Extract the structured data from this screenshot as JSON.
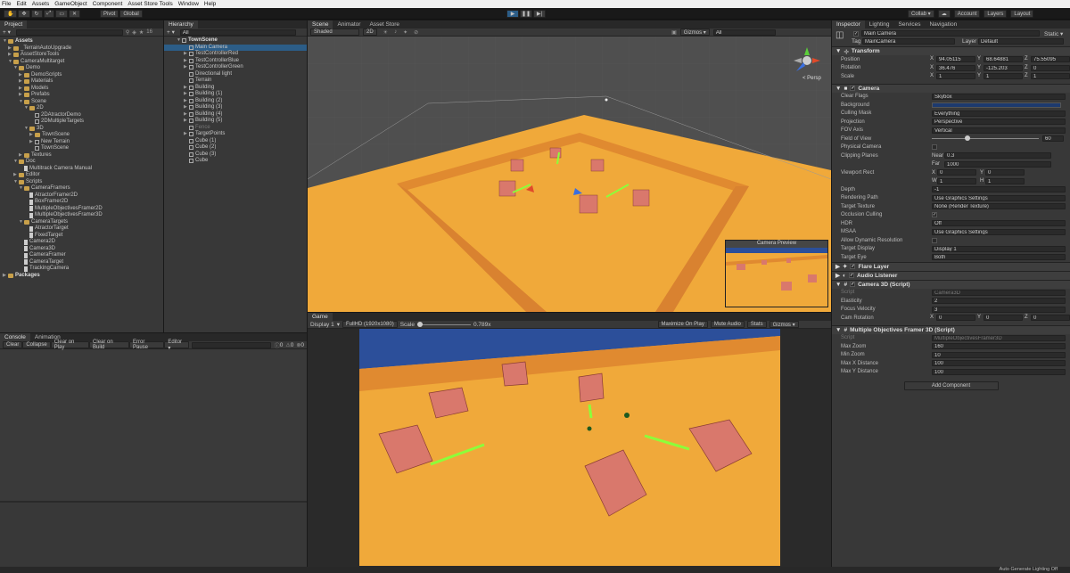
{
  "menu": [
    "File",
    "Edit",
    "Assets",
    "GameObject",
    "Component",
    "Asset Store Tools",
    "Window",
    "Help"
  ],
  "toolbar": {
    "pivot": "Pivot",
    "global": "Global",
    "collab": "Collab ▾",
    "account": "Account",
    "layers": "Layers",
    "layout": "Layout"
  },
  "project": {
    "tab": "Project",
    "count": "16",
    "items": [
      {
        "label": "Assets",
        "depth": 0,
        "bold": true,
        "arrow": "▼",
        "icon": "folder"
      },
      {
        "label": "_TerrainAutoUpgrade",
        "depth": 1,
        "arrow": "▶",
        "icon": "folder"
      },
      {
        "label": "AssetStoreTools",
        "depth": 1,
        "arrow": "▶",
        "icon": "folder"
      },
      {
        "label": "CameraMultitarget",
        "depth": 1,
        "arrow": "▼",
        "icon": "folder"
      },
      {
        "label": "Demo",
        "depth": 2,
        "arrow": "▼",
        "icon": "folder"
      },
      {
        "label": "DemoScripts",
        "depth": 3,
        "arrow": "▶",
        "icon": "folder"
      },
      {
        "label": "Materials",
        "depth": 3,
        "arrow": "▶",
        "icon": "folder"
      },
      {
        "label": "Models",
        "depth": 3,
        "arrow": "▶",
        "icon": "folder"
      },
      {
        "label": "Prefabs",
        "depth": 3,
        "arrow": "▶",
        "icon": "folder"
      },
      {
        "label": "Scene",
        "depth": 3,
        "arrow": "▼",
        "icon": "folder"
      },
      {
        "label": "2D",
        "depth": 4,
        "arrow": "▼",
        "icon": "folder"
      },
      {
        "label": "2DAtractorDemo",
        "depth": 5,
        "arrow": "",
        "icon": "cube"
      },
      {
        "label": "2DMultipleTargets",
        "depth": 5,
        "arrow": "",
        "icon": "cube"
      },
      {
        "label": "3D",
        "depth": 4,
        "arrow": "▼",
        "icon": "folder"
      },
      {
        "label": "TownScene",
        "depth": 5,
        "arrow": "▶",
        "icon": "folder"
      },
      {
        "label": "New Terrain",
        "depth": 5,
        "arrow": "▶",
        "icon": "cube"
      },
      {
        "label": "TownScene",
        "depth": 5,
        "arrow": "",
        "icon": "cube"
      },
      {
        "label": "Textures",
        "depth": 3,
        "arrow": "▶",
        "icon": "folder"
      },
      {
        "label": "Doc",
        "depth": 2,
        "arrow": "▼",
        "icon": "folder"
      },
      {
        "label": "Multitrack Camera Manual",
        "depth": 3,
        "arrow": "",
        "icon": "script"
      },
      {
        "label": "Editor",
        "depth": 2,
        "arrow": "▶",
        "icon": "folder"
      },
      {
        "label": "Scripts",
        "depth": 2,
        "arrow": "▼",
        "icon": "folder"
      },
      {
        "label": "CameraFramers",
        "depth": 3,
        "arrow": "▼",
        "icon": "folder"
      },
      {
        "label": "AtractorFramer2D",
        "depth": 4,
        "arrow": "",
        "icon": "script"
      },
      {
        "label": "BoxFramer2D",
        "depth": 4,
        "arrow": "",
        "icon": "script"
      },
      {
        "label": "MultipleObjectivesFramer2D",
        "depth": 4,
        "arrow": "",
        "icon": "script"
      },
      {
        "label": "MultipleObjectivesFramer3D",
        "depth": 4,
        "arrow": "",
        "icon": "script"
      },
      {
        "label": "CameraTargets",
        "depth": 3,
        "arrow": "▼",
        "icon": "folder"
      },
      {
        "label": "AtractorTarget",
        "depth": 4,
        "arrow": "",
        "icon": "script"
      },
      {
        "label": "FixedTarget",
        "depth": 4,
        "arrow": "",
        "icon": "script"
      },
      {
        "label": "Camera2D",
        "depth": 3,
        "arrow": "",
        "icon": "script"
      },
      {
        "label": "Camera3D",
        "depth": 3,
        "arrow": "",
        "icon": "script"
      },
      {
        "label": "CameraFramer",
        "depth": 3,
        "arrow": "",
        "icon": "script"
      },
      {
        "label": "CameraTarget",
        "depth": 3,
        "arrow": "",
        "icon": "script"
      },
      {
        "label": "TrackingCamera",
        "depth": 3,
        "arrow": "",
        "icon": "script"
      },
      {
        "label": "Packages",
        "depth": 0,
        "bold": true,
        "arrow": "▶",
        "icon": "folder"
      }
    ]
  },
  "hierarchy": {
    "tab": "Hierarchy",
    "items": [
      {
        "label": "TownScene",
        "depth": 0,
        "arrow": "▼",
        "bold": true
      },
      {
        "label": "Main Camera",
        "depth": 1,
        "arrow": "",
        "selected": true
      },
      {
        "label": "TestControllerRed",
        "depth": 1,
        "arrow": "▶"
      },
      {
        "label": "TestControllerBlue",
        "depth": 1,
        "arrow": "▶"
      },
      {
        "label": "TestControllerGreen",
        "depth": 1,
        "arrow": "▶"
      },
      {
        "label": "Directional light",
        "depth": 1,
        "arrow": ""
      },
      {
        "label": "Terrain",
        "depth": 1,
        "arrow": ""
      },
      {
        "label": "Building",
        "depth": 1,
        "arrow": "▶"
      },
      {
        "label": "Building (1)",
        "depth": 1,
        "arrow": "▶"
      },
      {
        "label": "Building (2)",
        "depth": 1,
        "arrow": "▶"
      },
      {
        "label": "Building (3)",
        "depth": 1,
        "arrow": "▶"
      },
      {
        "label": "Building (4)",
        "depth": 1,
        "arrow": "▶"
      },
      {
        "label": "Building (5)",
        "depth": 1,
        "arrow": "▶"
      },
      {
        "label": "Fence",
        "depth": 1,
        "arrow": "",
        "dim": true
      },
      {
        "label": "TargetPoints",
        "depth": 1,
        "arrow": "▶"
      },
      {
        "label": "Cube (1)",
        "depth": 1,
        "arrow": ""
      },
      {
        "label": "Cube (2)",
        "depth": 1,
        "arrow": ""
      },
      {
        "label": "Cube (3)",
        "depth": 1,
        "arrow": ""
      },
      {
        "label": "Cube",
        "depth": 1,
        "arrow": ""
      }
    ]
  },
  "console": {
    "tabs": [
      "Console",
      "Animation"
    ],
    "buttons": [
      "Clear",
      "Collapse",
      "Clear on Play",
      "Clear on Build",
      "Error Pause",
      "Editor ▾"
    ],
    "counts": [
      "0",
      "0",
      "0"
    ]
  },
  "scene": {
    "tabs": [
      "Scene",
      "Animator",
      "Asset Store"
    ],
    "shading": "Shaded",
    "mode2d": "2D",
    "gizmos": "Gizmos ▾",
    "search": "All",
    "persp": "< Persp",
    "preview_title": "Camera Preview"
  },
  "game": {
    "tab": "Game",
    "display": "Display 1",
    "resolution": "FullHD (1920x1080)",
    "scale_label": "Scale",
    "scale_value": "0.789x",
    "maximize": "Maximize On Play",
    "mute": "Mute Audio",
    "stats": "Stats",
    "gizmos": "Gizmos ▾"
  },
  "inspector": {
    "tabs": [
      "Inspector",
      "Lighting",
      "Services",
      "Navigation"
    ],
    "object_name": "Main Camera",
    "static": "Static ▾",
    "tag_label": "Tag",
    "tag": "MainCamera",
    "layer_label": "Layer",
    "layer": "Default",
    "transform": {
      "title": "Transform",
      "position": [
        "94.05115",
        "68.64881",
        "75.55095"
      ],
      "rotation": [
        "36.476",
        "-125.203",
        "0"
      ],
      "scale": [
        "1",
        "1",
        "1"
      ],
      "labels": [
        "Position",
        "Rotation",
        "Scale"
      ]
    },
    "camera": {
      "title": "Camera",
      "fields": [
        [
          "Clear Flags",
          "Skybox"
        ],
        [
          "Background",
          ""
        ],
        [
          "Culling Mask",
          "Everything"
        ],
        [
          "Projection",
          "Perspective"
        ],
        [
          "FOV Axis",
          "Vertical"
        ],
        [
          "Field of View",
          "60"
        ],
        [
          "Physical Camera",
          ""
        ],
        [
          "Clipping Planes",
          ""
        ],
        [
          "",
          ""
        ],
        [
          "Viewport Rect",
          ""
        ],
        [
          "",
          ""
        ],
        [
          "Depth",
          "-1"
        ],
        [
          "Rendering Path",
          "Use Graphics Settings"
        ],
        [
          "Target Texture",
          "None (Render Texture)"
        ],
        [
          "Occlusion Culling",
          ""
        ],
        [
          "HDR",
          "Off"
        ],
        [
          "MSAA",
          "Use Graphics Settings"
        ],
        [
          "Allow Dynamic Resolution",
          ""
        ],
        [
          "Target Display",
          "Display 1"
        ],
        [
          "Target Eye",
          "Both"
        ]
      ],
      "near": "0.3",
      "far": "1000",
      "vx": "0",
      "vy": "0",
      "vw": "1",
      "vh": "1"
    },
    "flare": "Flare Layer",
    "audio": "Audio Listener",
    "camera3d": {
      "title": "Camera 3D (Script)",
      "script": "Camera3D",
      "fields": [
        [
          "Script",
          "Camera3D"
        ],
        [
          "Elasticity",
          "2"
        ],
        [
          "Focus Velocity",
          "3"
        ],
        [
          "Cam Rotation",
          ""
        ]
      ],
      "rot": [
        "0",
        "0",
        "0"
      ]
    },
    "framer": {
      "title": "Multiple Objectives Framer 3D (Script)",
      "fields": [
        [
          "Script",
          "MultipleObjectivesFramer3D"
        ],
        [
          "Max Zoom",
          "160"
        ],
        [
          "Min Zoom",
          "10"
        ],
        [
          "Max X Distance",
          "100"
        ],
        [
          "Max Y Distance",
          "100"
        ]
      ]
    },
    "add_component": "Add Component"
  },
  "status": "Auto Generate Lighting Off",
  "colors": {
    "bg": "#383838",
    "sand": "#f0a93a",
    "fence": "#e08a30",
    "sky": "#2c4f9a",
    "selected": "#2c5d87",
    "building": "#d9786c"
  }
}
